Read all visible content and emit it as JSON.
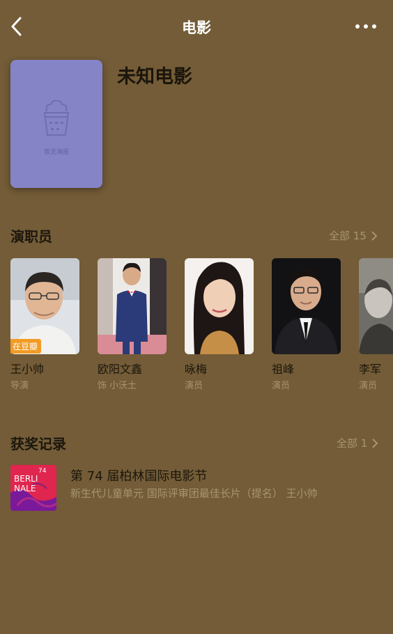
{
  "navbar": {
    "title": "电影"
  },
  "movie": {
    "title": "未知电影",
    "poster_placeholder": "暂无海报"
  },
  "cast_section": {
    "title": "演职员",
    "more_label": "全部 15",
    "members": [
      {
        "name": "王小帅",
        "role": "导演",
        "badge": "在豆瓣"
      },
      {
        "name": "欧阳文鑫",
        "role": "饰 小沃土"
      },
      {
        "name": "咏梅",
        "role": "演员"
      },
      {
        "name": "祖峰",
        "role": "演员"
      },
      {
        "name": "李军",
        "role": "演员"
      }
    ]
  },
  "awards_section": {
    "title": "获奖记录",
    "more_label": "全部 1",
    "items": [
      {
        "title": "第 74 届柏林国际电影节",
        "description": "新生代儿童单元 国际评审团最佳长片（提名） 王小帅",
        "logo_text": {
          "line1": "BERLI",
          "line2": "NALE",
          "number": "74"
        }
      }
    ]
  },
  "colors": {
    "background": "#735c37",
    "secondary_text": "#a89570",
    "poster": "#8484c6",
    "badge": "#f29b25"
  }
}
